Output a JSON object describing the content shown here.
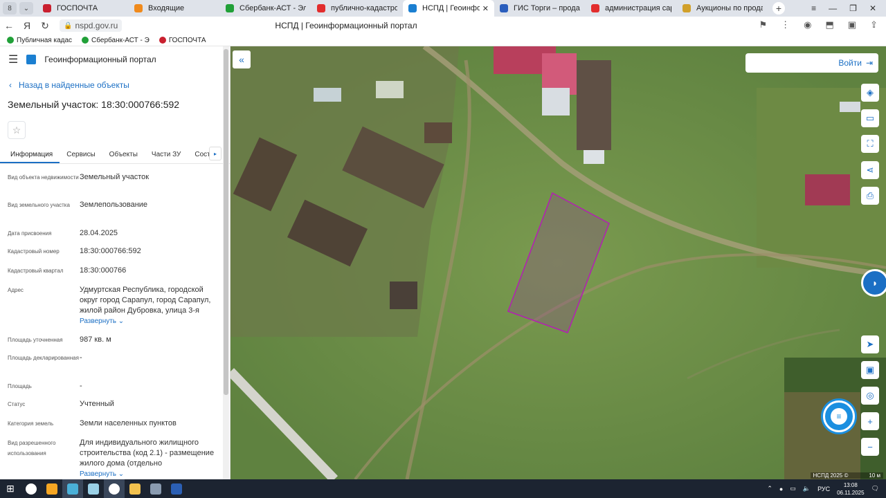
{
  "browser": {
    "tabs": [
      {
        "title": "ГОСПОЧТА",
        "color": "#c9202f"
      },
      {
        "title": "Входящие",
        "color": "#f08a1c"
      },
      {
        "title": "Сбербанк-АСТ - Электро",
        "color": "#21a038"
      },
      {
        "title": "публично-кадастровая к",
        "color": "#e22d2d"
      },
      {
        "title": "НСПД | Геоинформаци",
        "color": "#1b7fd1",
        "active": true
      },
      {
        "title": "ГИС Торги – продажи гос",
        "color": "#2a5ebd"
      },
      {
        "title": "администрация сарапул",
        "color": "#e22d2d"
      },
      {
        "title": "Аукционы по продаже пр",
        "color": "#d1a02a"
      }
    ],
    "url": "nspd.gov.ru",
    "page_title": "НСПД | Геоинформационный портал",
    "bookmarks": [
      {
        "label": "Публичная кадас",
        "color": "#21a038"
      },
      {
        "label": "Сбербанк-АСТ - Э",
        "color": "#21a038"
      },
      {
        "label": "ГОСПОЧТА",
        "color": "#c9202f"
      }
    ]
  },
  "panel": {
    "header_title": "Геоинформационный портал",
    "back_label": "Назад в найденные объекты",
    "object_title": "Земельный участок: 18:30:000766:592",
    "tabs": [
      "Информация",
      "Сервисы",
      "Объекты",
      "Части ЗУ",
      "Соста"
    ],
    "rows": [
      {
        "k": "Вид объекта недвижимости",
        "v": "Земельный участок"
      },
      {
        "k": "Вид земельного участка",
        "v": "Землепользование"
      },
      {
        "k": "Дата присвоения",
        "v": "28.04.2025"
      },
      {
        "k": "Кадастровый номер",
        "v": "18:30:000766:592"
      },
      {
        "k": "Кадастровый квартал",
        "v": "18:30:000766"
      },
      {
        "k": "Адрес",
        "v": "Удмуртская Республика, городской округ город Сарапул, город Сарапул, жилой район Дубровка, улица 3-я",
        "expand": "Развернуть"
      },
      {
        "k": "Площадь уточненная",
        "v": "987 кв. м"
      },
      {
        "k": "Площадь декларированная",
        "v": "-"
      },
      {
        "k": "Площадь",
        "v": "-"
      },
      {
        "k": "Статус",
        "v": "Учтенный"
      },
      {
        "k": "Категория земель",
        "v": "Земли населенных пунктов"
      },
      {
        "k": "Вид разрешенного использования",
        "v": "Для индивидуального жилищного строительства (код 2.1) - размещение жилого дома (отдельно",
        "expand": "Развернуть"
      }
    ]
  },
  "map": {
    "login_label": "Войти",
    "attribution": "НСПД 2025 ©",
    "scale": "10 м",
    "parcel_color": "#b41eb4"
  },
  "taskbar": {
    "lang": "РУС",
    "time": "13:08",
    "date": "06.11.2025"
  }
}
